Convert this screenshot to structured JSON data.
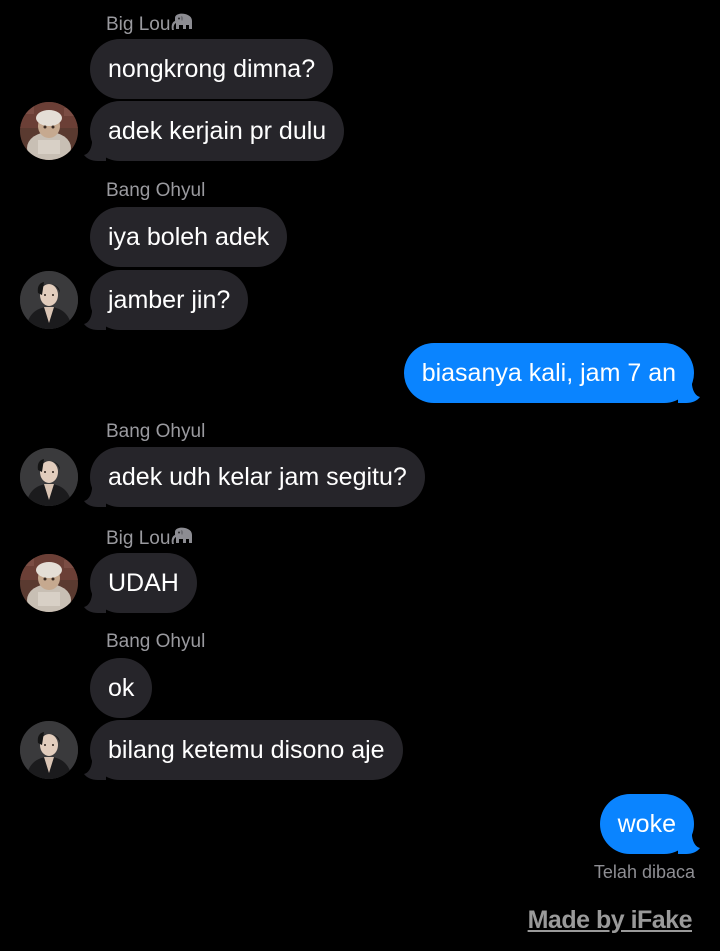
{
  "thread": {
    "sender_biglou": "Big Lou",
    "sender_biglou_emoji": "elephant-emoji",
    "sender_ohyul": "Bang Ohyul",
    "messages": [
      {
        "from": "Big Lou",
        "text": "nongkrong dimna?"
      },
      {
        "from": "Big Lou",
        "text": "adek kerjain pr dulu"
      },
      {
        "from": "Bang Ohyul",
        "text": "iya boleh adek"
      },
      {
        "from": "Bang Ohyul",
        "text": "jamber jin?"
      },
      {
        "from": "me",
        "text": "biasanya kali, jam 7 an"
      },
      {
        "from": "Bang Ohyul",
        "text": "adek udh kelar jam segitu?"
      },
      {
        "from": "Big Lou",
        "text": "UDAH"
      },
      {
        "from": "Bang Ohyul",
        "text": "ok"
      },
      {
        "from": "Bang Ohyul",
        "text": "bilang ketemu disono aje"
      },
      {
        "from": "me",
        "text": "woke"
      }
    ],
    "read_receipt": "Telah dibaca"
  },
  "watermark": "Made by iFake",
  "colors": {
    "background": "#000000",
    "incoming_bubble": "#26252a",
    "outgoing_bubble": "#0a84ff",
    "sender_name": "#9a9a9f",
    "read_receipt": "#8e8e93"
  }
}
